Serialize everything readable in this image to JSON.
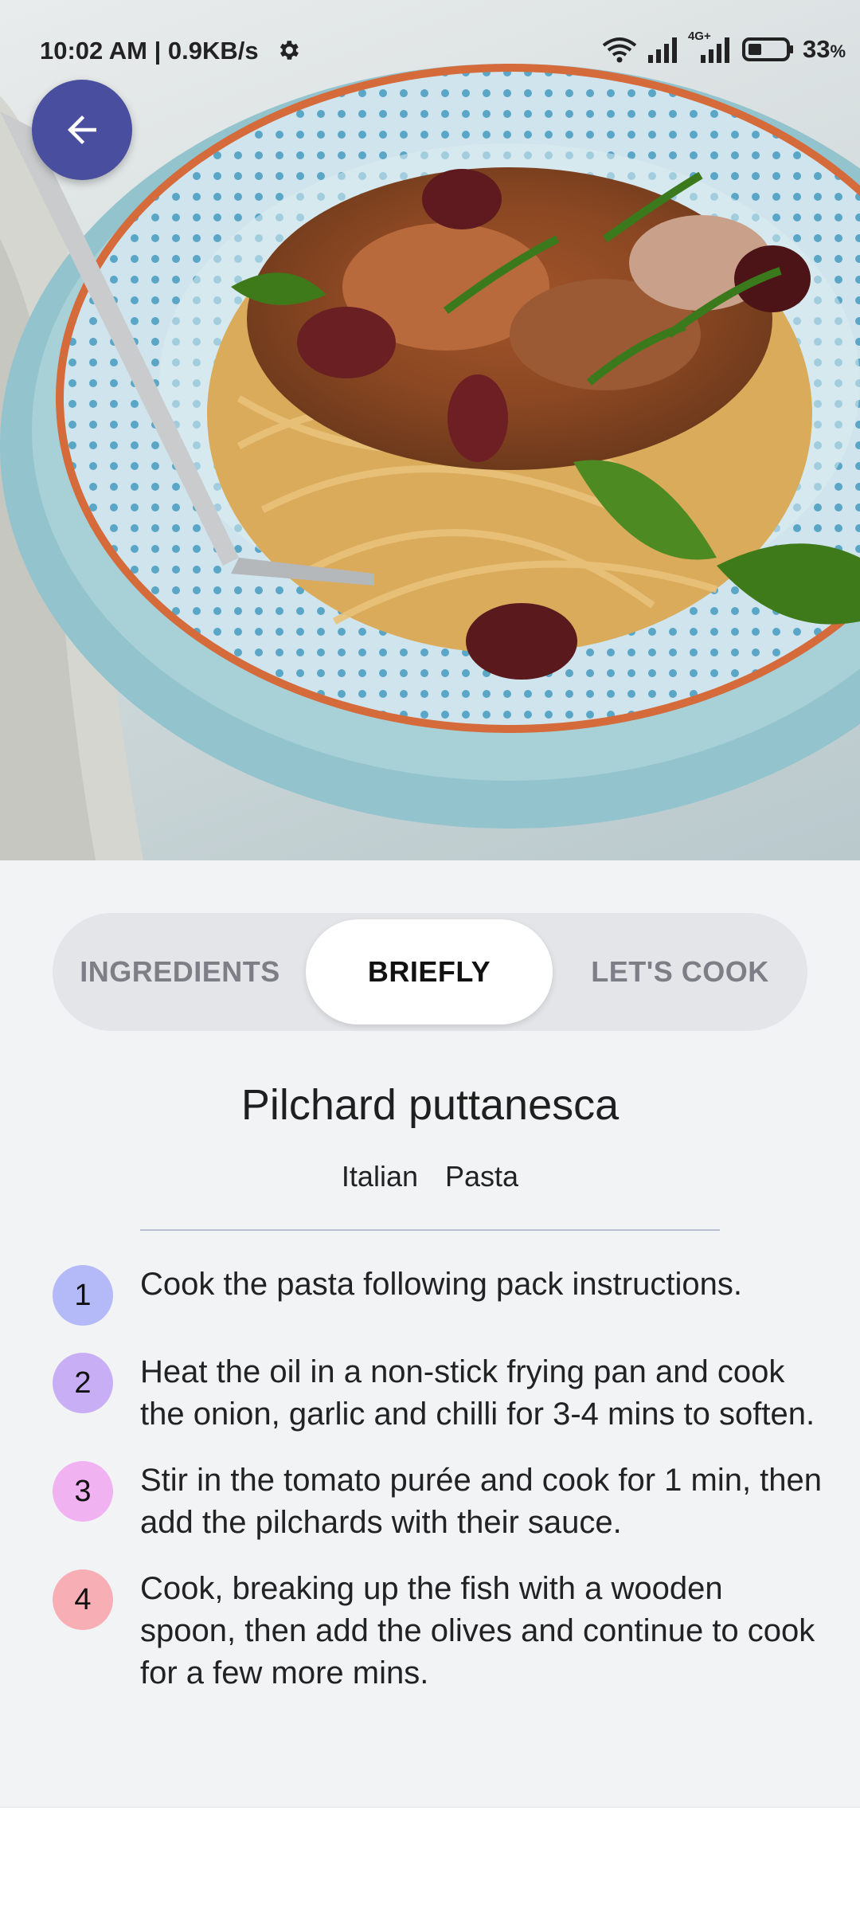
{
  "status_bar": {
    "time": "10:02 AM | 0.9KB/s",
    "network_type": "4G+",
    "battery": "33",
    "battery_unit": "%"
  },
  "hero": {
    "image": "photo of pilchard puttanesca spaghetti in a blue patterned bowl"
  },
  "tabs": [
    {
      "label": "INGREDIENTS",
      "selected": false
    },
    {
      "label": "BRIEFLY",
      "selected": true
    },
    {
      "label": "LET'S COOK",
      "selected": false
    }
  ],
  "recipe": {
    "title": "Pilchard puttanesca",
    "tags": [
      "Italian",
      "Pasta"
    ]
  },
  "steps": [
    {
      "number": "1",
      "color": "#b3baf7",
      "text": "Cook the pasta following pack instructions."
    },
    {
      "number": "2",
      "color": "#c8aef5",
      "text": "Heat the oil in a non-stick frying pan and cook the onion, garlic and chilli for 3-4 mins to soften."
    },
    {
      "number": "3",
      "color": "#f1b2f1",
      "text": "Stir in the tomato purée and cook for 1 min, then add the pilchards with their sauce."
    },
    {
      "number": "4",
      "color": "#f8aeb5",
      "text": "Cook, breaking up the fish with a wooden spoon, then add the olives and continue to cook for a few more mins."
    }
  ]
}
